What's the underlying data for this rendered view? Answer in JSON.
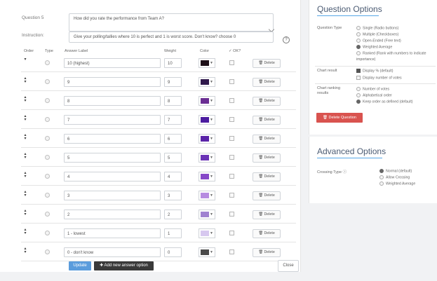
{
  "question": {
    "label": "Question 5",
    "value": "How did you rate the performance from Team A?",
    "instruction_label": "Instruction:",
    "instruction_value": "Give your polling/tallies where 10 is perfect and 1 is worst score. Don't know? choose 0",
    "help_icon": "help-circle-icon"
  },
  "columns": {
    "order": "Order",
    "type": "Type",
    "answer_label": "Answer Label",
    "weight": "Weight",
    "color": "Color",
    "ok": "OK?"
  },
  "rows": [
    {
      "answer": "10 (highest)",
      "weight": "10",
      "color": "#1d0f18",
      "delete": "Delete"
    },
    {
      "answer": "9",
      "weight": "9",
      "color": "#30194c",
      "delete": "Delete"
    },
    {
      "answer": "8",
      "weight": "8",
      "color": "#6b2e93",
      "delete": "Delete"
    },
    {
      "answer": "7",
      "weight": "7",
      "color": "#4c1ca0",
      "delete": "Delete"
    },
    {
      "answer": "6",
      "weight": "6",
      "color": "#5a24a8",
      "delete": "Delete"
    },
    {
      "answer": "5",
      "weight": "5",
      "color": "#6a33b6",
      "delete": "Delete"
    },
    {
      "answer": "4",
      "weight": "4",
      "color": "#8648c8",
      "delete": "Delete"
    },
    {
      "answer": "3",
      "weight": "3",
      "color": "#b68ce0",
      "delete": "Delete"
    },
    {
      "answer": "2",
      "weight": "2",
      "color": "#a082d0",
      "delete": "Delete"
    },
    {
      "answer": "1 - lowest",
      "weight": "1",
      "color": "#d7c8ef",
      "delete": "Delete"
    },
    {
      "answer": "0 - don't know",
      "weight": "0",
      "color": "#4a4a4a",
      "delete": "Delete"
    }
  ],
  "buttons": {
    "update": "Update",
    "add": "Add new answer option",
    "close": "Close"
  },
  "question_options": {
    "title": "Question Options",
    "question_type_label": "Question Type",
    "types": [
      {
        "label": "Single (Radio buttons)",
        "selected": false
      },
      {
        "label": "Multiple (Checkboxes)",
        "selected": false
      },
      {
        "label": "Open-Ended (Free text)",
        "selected": false
      },
      {
        "label": "Weighted Average",
        "selected": true
      },
      {
        "label": "Ranked (Rank with numbers to indicate",
        "selected": false
      }
    ],
    "ranked_note": "importance)",
    "chart_result_label": "Chart result",
    "chart_results": [
      {
        "label": "Display % (default)",
        "checked": true
      },
      {
        "label": "Display number of votes",
        "checked": false
      }
    ],
    "chart_ranking_label": "Chart ranking",
    "chart_ranking_label2": "results",
    "ranking_options": [
      {
        "label": "Number of votes",
        "selected": false
      },
      {
        "label": "Alphabetical order",
        "selected": false
      },
      {
        "label": "Keep order as defined (default)",
        "selected": true
      }
    ],
    "delete_question": "Delete Question"
  },
  "advanced_options": {
    "title": "Advanced Options",
    "crossing_type_label": "Crossing Type",
    "crossing_options": [
      {
        "label": "Normal (default)",
        "selected": true
      },
      {
        "label": "Allow Crossing",
        "selected": false
      },
      {
        "label": "Weighted Average",
        "selected": false
      }
    ]
  }
}
